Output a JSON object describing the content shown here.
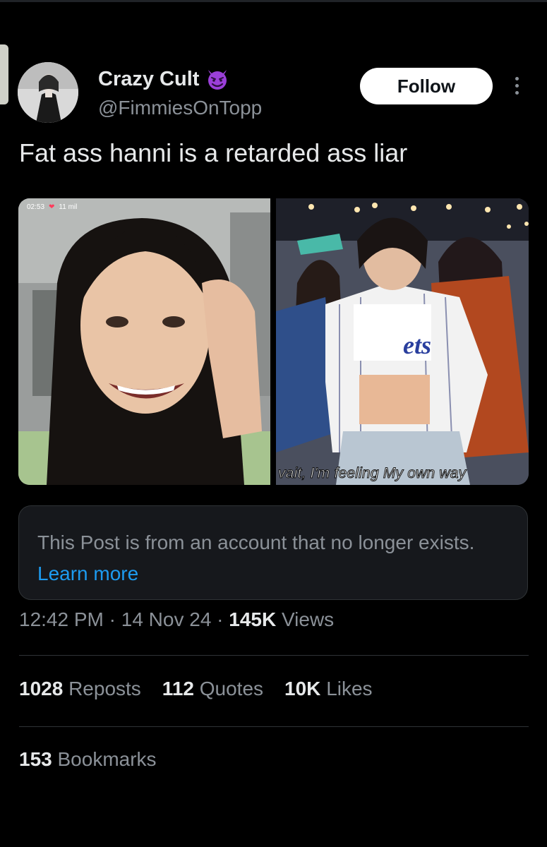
{
  "author": {
    "display_name": "Crazy Cult",
    "handle": "@FimmiesOnTopp",
    "badge_icon": "smiling-devil-icon"
  },
  "follow_label": "Follow",
  "post": {
    "text": "Fat ass hanni is a retarded ass liar"
  },
  "media": {
    "left": {
      "status_time": "02:53",
      "status_likes": "11 mil"
    },
    "right": {
      "caption": "vait, I'm feeling My own way"
    }
  },
  "notice": {
    "text": "This Post is from an account that no longer exists.",
    "link": "Learn more"
  },
  "meta": {
    "time": "12:42 PM",
    "date": "14 Nov 24",
    "views_count": "145K",
    "views_label": "Views"
  },
  "stats": {
    "reposts_count": "1028",
    "reposts_label": "Reposts",
    "quotes_count": "112",
    "quotes_label": "Quotes",
    "likes_count": "10K",
    "likes_label": "Likes",
    "bookmarks_count": "153",
    "bookmarks_label": "Bookmarks"
  },
  "colors": {
    "background": "#000000",
    "link_blue": "#1d9bf0",
    "secondary_text": "#8b9198",
    "devil_purple": "#9b3fd9"
  }
}
